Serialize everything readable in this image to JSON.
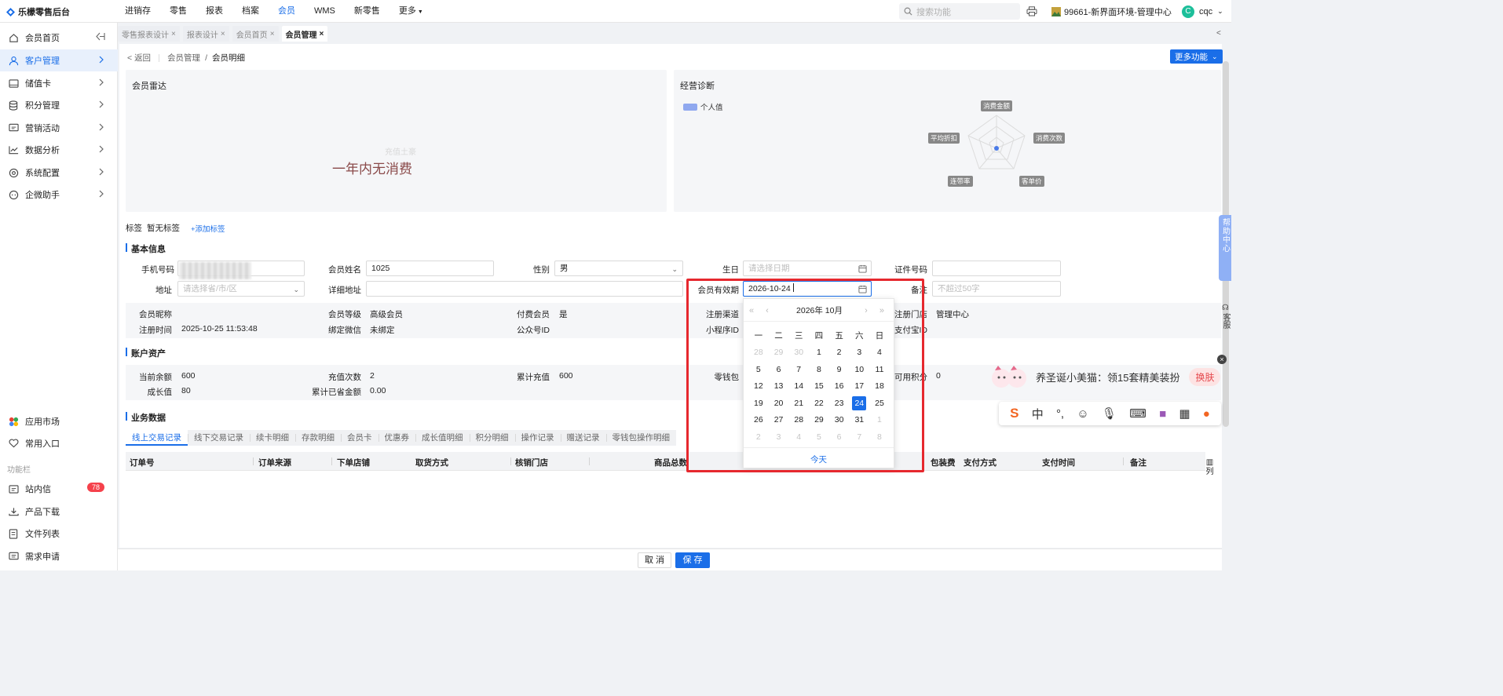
{
  "app": {
    "title": "乐檬零售后台"
  },
  "topnav": [
    "进销存",
    "零售",
    "报表",
    "档案",
    "会员",
    "WMS",
    "新零售",
    "更多"
  ],
  "search": {
    "placeholder": "搜索功能"
  },
  "store": "99661-新界面环境-管理中心",
  "user": {
    "avatar": "C",
    "name": "cqc"
  },
  "sidebar": {
    "items": [
      {
        "label": "会员首页",
        "icon": "home-icon"
      },
      {
        "label": "客户管理",
        "icon": "user-icon"
      },
      {
        "label": "储值卡",
        "icon": "card-icon"
      },
      {
        "label": "积分管理",
        "icon": "database-icon"
      },
      {
        "label": "营销活动",
        "icon": "campaign-icon"
      },
      {
        "label": "数据分析",
        "icon": "chart-icon"
      },
      {
        "label": "系统配置",
        "icon": "gear-icon"
      },
      {
        "label": "企微助手",
        "icon": "chat-icon"
      }
    ],
    "bottom": [
      {
        "label": "应用市场",
        "icon": "app-market-icon"
      },
      {
        "label": "常用入口",
        "icon": "heart-icon"
      }
    ],
    "section": "功能栏",
    "func": [
      {
        "label": "站内信",
        "icon": "mail-icon",
        "badge": "78"
      },
      {
        "label": "产品下载",
        "icon": "download-icon"
      },
      {
        "label": "文件列表",
        "icon": "file-icon"
      },
      {
        "label": "需求申请",
        "icon": "request-icon"
      }
    ]
  },
  "page_tabs": [
    {
      "label": "零售报表设计"
    },
    {
      "label": "报表设计"
    },
    {
      "label": "会员首页"
    },
    {
      "label": "会员管理"
    }
  ],
  "breadcrumb": {
    "back": "返回",
    "parent": "会员管理",
    "current": "会员明细",
    "sep": "/"
  },
  "more_btn": "更多功能",
  "radar_panel": {
    "title": "会员雷达",
    "empty": "一年内无消费",
    "ghost": "充值土豪"
  },
  "diag_panel": {
    "title": "经营诊断",
    "legend": "个人值",
    "axes": [
      "消费金额",
      "消费次数",
      "客单价",
      "连带率",
      "平均折扣"
    ]
  },
  "tags": {
    "label": "标签",
    "value": "暂无标签",
    "add": "+添加标签"
  },
  "basic": {
    "title": "基本信息",
    "phone_label": "手机号码",
    "phone_value": "",
    "name_label": "会员姓名",
    "name_value": "1025",
    "gender_label": "性别",
    "gender_value": "男",
    "birthday_label": "生日",
    "birthday_placeholder": "请选择日期",
    "id_label": "证件号码",
    "id_value": "",
    "address_label": "地址",
    "address_placeholder": "请选择省/市/区",
    "detail_label": "详细地址",
    "detail_value": "",
    "validity_label": "会员有效期",
    "validity_value": "2026-10-24",
    "remark_label": "备注",
    "remark_placeholder": "不超过50字"
  },
  "info": {
    "nickname_label": "会员昵称",
    "nickname_value": "",
    "level_label": "会员等级",
    "level_value": "高级会员",
    "paid_label": "付费会员",
    "paid_value": "是",
    "channel_label": "注册渠道",
    "store_label": "注册门店",
    "store_value": "管理中心",
    "regtime_label": "注册时间",
    "regtime_value": "2025-10-25 11:53:48",
    "wechat_label": "绑定微信",
    "wechat_value": "未绑定",
    "oa_label": "公众号ID",
    "oa_value": "",
    "mini_label": "小程序ID",
    "alipay_label": "支付宝ID"
  },
  "assets": {
    "title": "账户资产",
    "balance_label": "当前余额",
    "balance_value": "600",
    "rc_count_label": "充值次数",
    "rc_count_value": "2",
    "rc_total_label": "累计充值",
    "rc_total_value": "600",
    "change_label": "零钱包",
    "points_label": "可用积分",
    "points_value": "0",
    "growth_label": "成长值",
    "growth_value": "80",
    "saved_label": "累计已省金额",
    "saved_value": "0.00"
  },
  "business": {
    "title": "业务数据",
    "tabs": [
      "线上交易记录",
      "线下交易记录",
      "续卡明细",
      "存款明细",
      "会员卡",
      "优惠券",
      "成长值明细",
      "积分明细",
      "操作记录",
      "赠送记录",
      "零钱包操作明细"
    ],
    "columns": [
      "订单号",
      "订单来源",
      "下单店铺",
      "取货方式",
      "核销门店",
      "商品总数",
      "包装费",
      "支付方式",
      "支付时间",
      "备注"
    ],
    "col_setting": "列"
  },
  "datepicker": {
    "title": "2026年 10月",
    "weekdays": [
      "一",
      "二",
      "三",
      "四",
      "五",
      "六",
      "日"
    ],
    "weeks": [
      [
        "28",
        "29",
        "30",
        "1",
        "2",
        "3",
        "4"
      ],
      [
        "5",
        "6",
        "7",
        "8",
        "9",
        "10",
        "11"
      ],
      [
        "12",
        "13",
        "14",
        "15",
        "16",
        "17",
        "18"
      ],
      [
        "19",
        "20",
        "21",
        "22",
        "23",
        "24",
        "25"
      ],
      [
        "26",
        "27",
        "28",
        "29",
        "30",
        "31",
        "1"
      ],
      [
        "2",
        "3",
        "4",
        "5",
        "6",
        "7",
        "8"
      ]
    ],
    "today": "今天",
    "selected": "24"
  },
  "help": {
    "label": "帮助中心",
    "service": "客服"
  },
  "ad": {
    "text": "养圣诞小美猫：领15套精美装扮",
    "btn": "换肤"
  },
  "ime": {
    "lang": "中"
  },
  "footer": {
    "cancel": "取 消",
    "save": "保 存"
  },
  "colors": {
    "primary": "#1a6ee8",
    "highlight": "#e6282e",
    "badge": "#f5414b"
  }
}
